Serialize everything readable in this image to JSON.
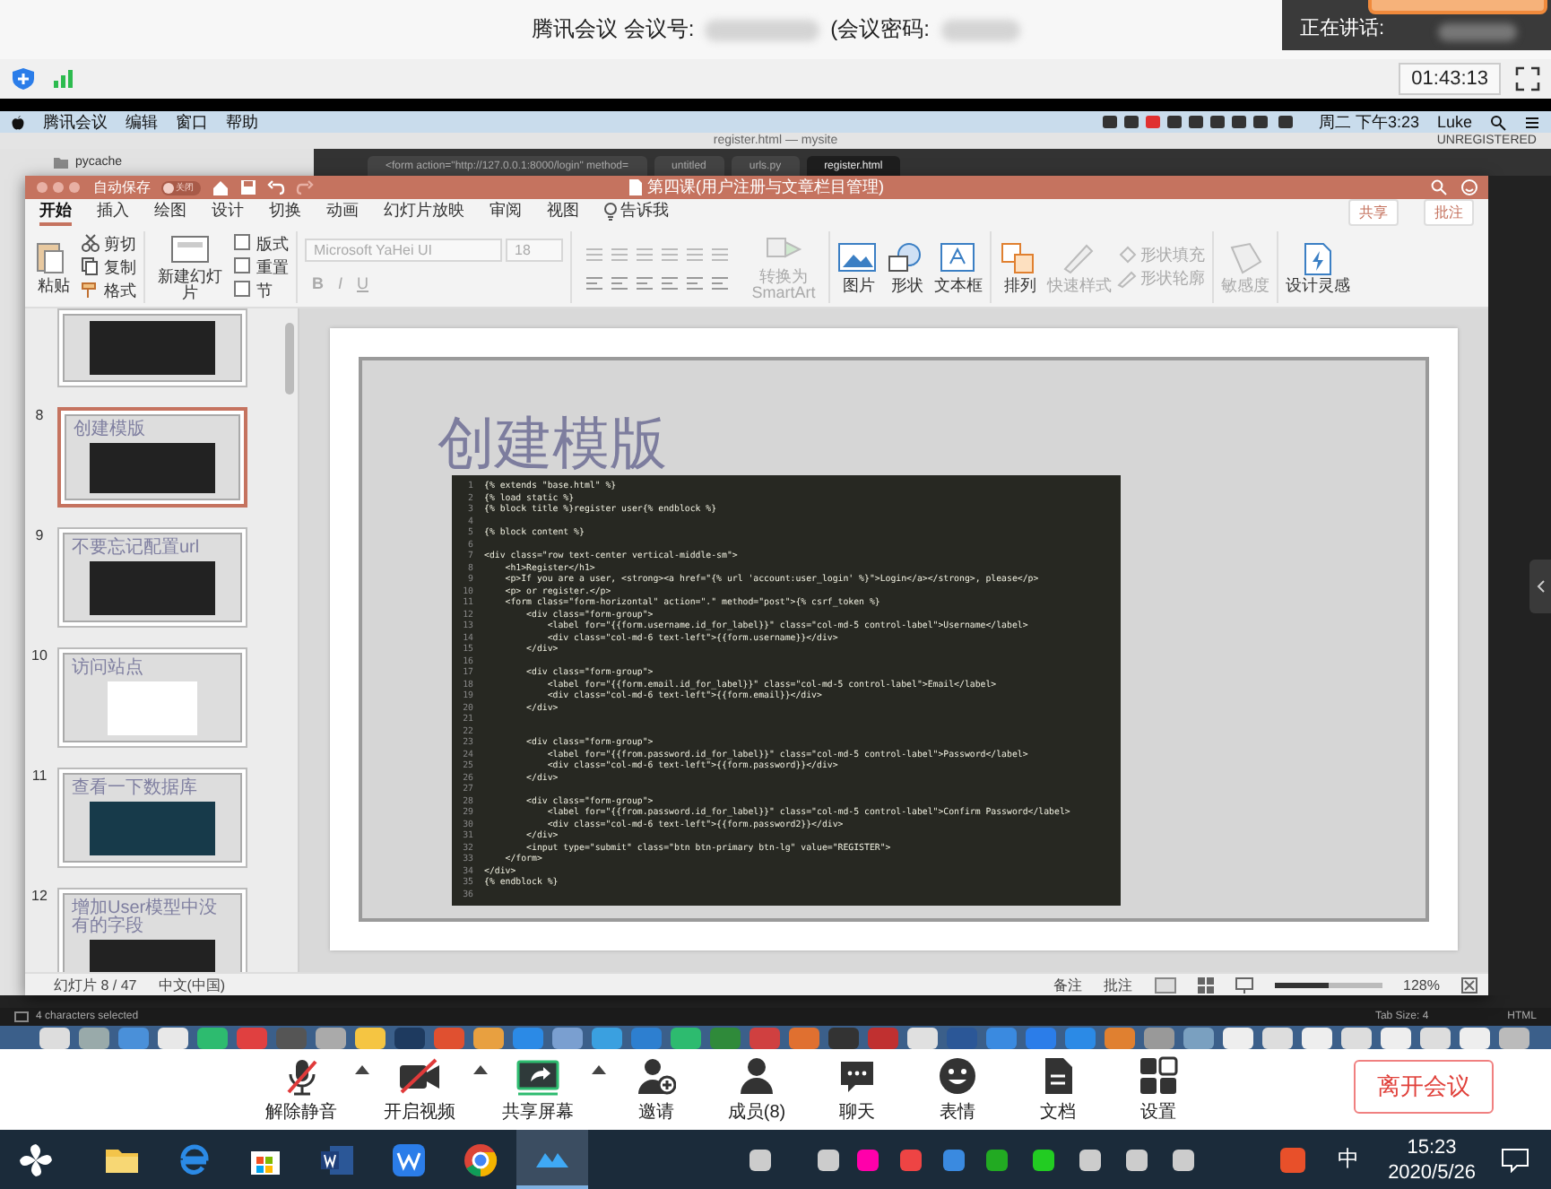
{
  "meeting_header": {
    "title": "腾讯会议 会议号:",
    "password_label": "(会议密码:",
    "speaking_label": "正在讲话:"
  },
  "meeting_status": {
    "timer": "01:43:13"
  },
  "mac_menubar": {
    "menus": [
      "腾讯会议",
      "编辑",
      "窗口",
      "帮助"
    ],
    "clock": "周二 下午3:23",
    "user": "Luke"
  },
  "editor": {
    "title": "register.html — mysite",
    "license": "UNREGISTERED",
    "folder": "pycache",
    "tabs": [
      {
        "label": "<form action=\"http://127.0.0.1:8000/login\" method=",
        "selected": false
      },
      {
        "label": "untitled",
        "selected": false
      },
      {
        "label": "urls.py",
        "selected": false
      },
      {
        "label": "register.html",
        "selected": true
      }
    ],
    "status": {
      "selection": "4 characters selected",
      "tab_size": "Tab Size: 4",
      "syntax": "HTML"
    }
  },
  "presentation": {
    "title": "第四课(用户注册与文章栏目管理)",
    "autosave": {
      "label": "自动保存",
      "state_text": "关闭",
      "on": false
    },
    "ribbon_tabs": [
      {
        "label": "开始",
        "selected": true,
        "kind": "tab"
      },
      {
        "label": "插入",
        "selected": false,
        "kind": "tab"
      },
      {
        "label": "绘图",
        "selected": false,
        "kind": "tab"
      },
      {
        "label": "设计",
        "selected": false,
        "kind": "tab"
      },
      {
        "label": "切换",
        "selected": false,
        "kind": "tab"
      },
      {
        "label": "动画",
        "selected": false,
        "kind": "tab"
      },
      {
        "label": "幻灯片放映",
        "selected": false,
        "kind": "tab"
      },
      {
        "label": "审阅",
        "selected": false,
        "kind": "tab"
      },
      {
        "label": "视图",
        "selected": false,
        "kind": "tab"
      },
      {
        "label": "告诉我",
        "selected": false,
        "kind": "tell"
      }
    ],
    "share": "共享",
    "comments": "批注",
    "ribbon": {
      "clipboard": {
        "paste": "粘贴",
        "cut": "剪切",
        "copy": "复制",
        "format": "格式"
      },
      "slides": {
        "new": "新建幻灯片",
        "layout": "版式",
        "reset": "重置",
        "section": "节"
      },
      "font": {
        "name": "Microsoft YaHei UI",
        "size": "18",
        "styles": [
          "B",
          "I",
          "U"
        ]
      },
      "smartart": "转换为SmartArt",
      "insert": [
        "图片",
        "形状",
        "文本框"
      ],
      "drawing": [
        {
          "label": "排列",
          "disabled": false
        },
        {
          "label": "快速样式",
          "disabled": true
        }
      ],
      "shape_format": [
        {
          "label": "形状填充",
          "disabled": true
        },
        {
          "label": "形状轮廓",
          "disabled": true
        }
      ],
      "sensitivity": {
        "label": "敏感度",
        "disabled": true
      },
      "designer": "设计灵感"
    },
    "thumbnails": [
      {
        "kind": "code",
        "selected": false
      },
      {
        "number": "8",
        "title": "创建模版",
        "kind": "code",
        "selected": true
      },
      {
        "number": "9",
        "title": "不要忘记配置url",
        "kind": "code",
        "selected": false
      },
      {
        "number": "10",
        "title": "访问站点",
        "kind": "page",
        "selected": false
      },
      {
        "number": "11",
        "title": "查看一下数据库",
        "kind": "terminal",
        "selected": false
      },
      {
        "number": "12",
        "title": "增加User模型中没有的字段",
        "kind": "code",
        "selected": false
      }
    ],
    "slide": {
      "title": "创建模版",
      "code_lines": [
        {
          "number": "1",
          "text": "{% extends \"base.html\" %}"
        },
        {
          "number": "2",
          "text": "{% load static %}"
        },
        {
          "number": "3",
          "text": "{% block title %}register user{% endblock %}"
        },
        {
          "number": "4"
        },
        {
          "number": "5",
          "text": "{% block content %}"
        },
        {
          "number": "6"
        },
        {
          "number": "7",
          "text": "<div class=\"row text-center vertical-middle-sm\">"
        },
        {
          "number": "8",
          "text": "    <h1>Register</h1>"
        },
        {
          "number": "9",
          "text": "    <p>If you are a user, <strong><a href=\"{% url 'account:user_login' %}\">Login</a></strong>, please</p>"
        },
        {
          "number": "10",
          "text": "    <p> or register.</p>"
        },
        {
          "number": "11",
          "text": "    <form class=\"form-horizontal\" action=\".\" method=\"post\">{% csrf_token %}"
        },
        {
          "number": "12",
          "text": "        <div class=\"form-group\">"
        },
        {
          "number": "13",
          "text": "            <label for=\"{{form.username.id_for_label}}\" class=\"col-md-5 control-label\">Username</label>"
        },
        {
          "number": "14",
          "text": "            <div class=\"col-md-6 text-left\">{{form.username}}</div>"
        },
        {
          "number": "15",
          "text": "        </div>"
        },
        {
          "number": "16"
        },
        {
          "number": "17",
          "text": "        <div class=\"form-group\">"
        },
        {
          "number": "18",
          "text": "            <label for=\"{{form.email.id_for_label}}\" class=\"col-md-5 control-label\">Email</label>"
        },
        {
          "number": "19",
          "text": "            <div class=\"col-md-6 text-left\">{{form.email}}</div>"
        },
        {
          "number": "20",
          "text": "        </div>"
        },
        {
          "number": "21"
        },
        {
          "number": "22"
        },
        {
          "number": "23",
          "text": "        <div class=\"form-group\">"
        },
        {
          "number": "24",
          "text": "            <label for=\"{{from.password.id_for_label}}\" class=\"col-md-5 control-label\">Password</label>"
        },
        {
          "number": "25",
          "text": "            <div class=\"col-md-6 text-left\">{{form.password}}</div>"
        },
        {
          "number": "26",
          "text": "        </div>"
        },
        {
          "number": "27"
        },
        {
          "number": "28",
          "text": "        <div class=\"form-group\">"
        },
        {
          "number": "29",
          "text": "            <label for=\"{{from.password.id_for_label}}\" class=\"col-md-5 control-label\">Confirm Password</label>"
        },
        {
          "number": "30",
          "text": "            <div class=\"col-md-6 text-left\">{{form.password2}}</div>"
        },
        {
          "number": "31",
          "text": "        </div>"
        },
        {
          "number": "32",
          "text": "        <input type=\"submit\" class=\"btn btn-primary btn-lg\" value=\"REGISTER\">"
        },
        {
          "number": "33",
          "text": "    </form>"
        },
        {
          "number": "34",
          "text": "</div>"
        },
        {
          "number": "35",
          "text": "{% endblock %}"
        },
        {
          "number": "36"
        }
      ]
    },
    "status": {
      "slide_counter": "幻灯片 8 / 47",
      "language": "中文(中国)",
      "notes": "备注",
      "comments": "批注",
      "zoom": {
        "level": 0.5,
        "reading": "128%"
      }
    }
  },
  "meeting_toolbar": {
    "items": [
      {
        "label": "解除静音",
        "kind": "mic",
        "menu": true
      },
      {
        "label": "开启视频",
        "kind": "camera",
        "menu": true
      },
      {
        "label": "共享屏幕",
        "kind": "share",
        "menu": true
      },
      {
        "label": "邀请",
        "kind": "invite",
        "menu": false
      },
      {
        "label": "成员(8)",
        "kind": "members",
        "menu": false
      },
      {
        "label": "聊天",
        "kind": "chat",
        "menu": false
      },
      {
        "label": "表情",
        "kind": "emoji",
        "menu": false
      },
      {
        "label": "文档",
        "kind": "document",
        "menu": false
      },
      {
        "label": "设置",
        "kind": "settings",
        "menu": false
      }
    ],
    "leave": "离开会议"
  },
  "taskbar": {
    "apps": [
      {
        "kind": "folder",
        "selected": false
      },
      {
        "kind": "browser",
        "selected": false
      },
      {
        "kind": "store",
        "selected": false
      },
      {
        "kind": "word",
        "selected": false
      },
      {
        "kind": "wps",
        "selected": false
      },
      {
        "kind": "chrome",
        "selected": false
      },
      {
        "kind": "meeting",
        "selected": true
      }
    ],
    "ime": "中",
    "time": "15:23",
    "date": "2020/5/26"
  }
}
